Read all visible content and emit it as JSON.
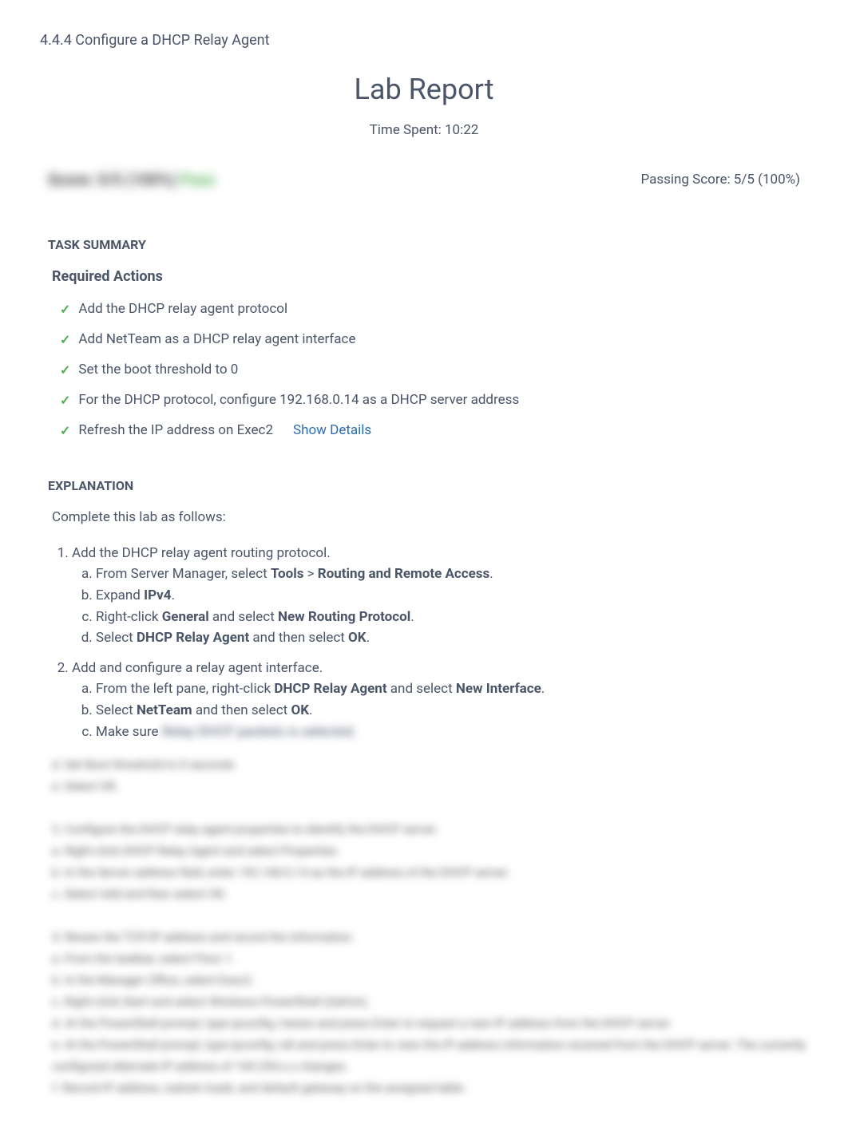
{
  "pageTitle": "4.4.4 Configure a DHCP Relay Agent",
  "reportTitle": "Lab Report",
  "timeSpent": "Time Spent: 10:22",
  "scoreBlur": {
    "prefix": "Score: 5/5 (100%) ",
    "suffix": "Pass"
  },
  "passingScore": "Passing Score: 5/5 (100%)",
  "taskSummaryHeader": "TASK SUMMARY",
  "requiredActionsHeader": "Required Actions",
  "actions": {
    "item0": "Add the DHCP relay agent protocol",
    "item1": "Add NetTeam as a DHCP relay agent interface",
    "item2": "Set the boot threshold to 0",
    "item3": "For the DHCP protocol, configure 192.168.0.14 as a DHCP server address",
    "item4": "Refresh the IP address on Exec2"
  },
  "showDetails": "Show Details",
  "explanationHeader": "EXPLANATION",
  "explanationIntro": "Complete this lab as follows:",
  "step1": {
    "title": "Add the DHCP relay agent routing protocol.",
    "a_pre": "From Server Manager, select ",
    "a_b1": "Tools",
    "a_mid": " > ",
    "a_b2": "Routing and Remote Access",
    "a_post": ".",
    "b_pre": "Expand ",
    "b_b1": "IPv4",
    "b_post": ".",
    "c_pre": "Right-click ",
    "c_b1": "General",
    "c_mid": " and select ",
    "c_b2": "New Routing Protocol",
    "c_post": ".",
    "d_pre": "Select ",
    "d_b1": "DHCP Relay Agent",
    "d_mid": " and then select ",
    "d_b2": "OK",
    "d_post": "."
  },
  "step2": {
    "title": "Add and configure a relay agent interface.",
    "a_pre": "From the left pane, right-click ",
    "a_b1": "DHCP Relay Agent",
    "a_mid": " and select ",
    "a_b2": "New Interface",
    "a_post": ".",
    "b_pre": "Select ",
    "b_b1": "NetTeam",
    "b_mid": " and then select ",
    "b_b2": "OK",
    "b_post": ".",
    "c_pre": "Make sure ",
    "c_blur": "Relay DHCP packets is selected."
  },
  "blurredBlock": "d. Set Boot threshold to 0 seconds\ne. Select OK.\n\n3. Configure the DHCP relay agent properties to identify the DHCP server.\na. Right-click DHCP Relay Agent and select Properties.\nb. In the Server address field, enter 192.168.0.14 as the IP address of the DHCP server.\nc. Select Add and then select OK.\n\n4. Renew the TCP/IP address and record the information.\na. From the taskbar, select Floor 1.\nb. In the Manager Office, select Exec2.\nc. Right-click Start and select Windows PowerShell (Admin).\nd. At the PowerShell prompt, type ipconfig /renew and press Enter to request a new IP address from the DHCP server.\ne. At the PowerShell prompt, type ipconfig /all and press Enter to view the IP address information received from the DHCP server. The currently configured alternate IP address of 169.254.x.x changes.\nf. Record IP address, subnet mask, and default gateway on the assigned table."
}
